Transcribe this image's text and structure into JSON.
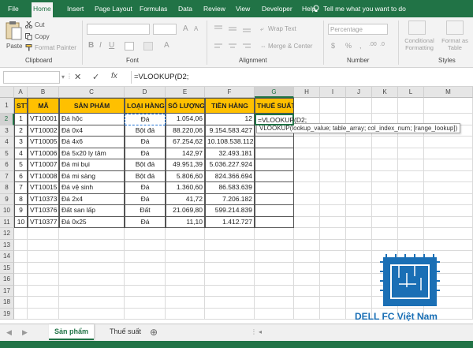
{
  "ribbon_tabs": [
    "File",
    "Home",
    "Insert",
    "Page Layout",
    "Formulas",
    "Data",
    "Review",
    "View",
    "Developer",
    "Help"
  ],
  "active_tab": "Home",
  "tell_me": "Tell me what you want to do",
  "clipboard": {
    "paste": "Paste",
    "cut": "Cut",
    "copy": "Copy",
    "format_painter": "Format Painter",
    "label": "Clipboard"
  },
  "font": {
    "label": "Font"
  },
  "alignment": {
    "wrap_text": "Wrap Text",
    "merge_center": "Merge & Center",
    "label": "Alignment"
  },
  "number": {
    "format": "Percentage",
    "label": "Number"
  },
  "styles": {
    "conditional_formatting": "Conditional Formatting",
    "format_as_table": "Format as Table",
    "label": "Styles"
  },
  "formula_bar": {
    "formula": "=VLOOKUP(D2;"
  },
  "columns": [
    "A",
    "B",
    "C",
    "D",
    "E",
    "F",
    "G",
    "H",
    "I",
    "J",
    "K",
    "L",
    "M"
  ],
  "rows": [
    "1",
    "2",
    "3",
    "4",
    "5",
    "6",
    "7",
    "8",
    "9",
    "10",
    "11",
    "12",
    "13",
    "14",
    "15",
    "16",
    "17",
    "18",
    "19"
  ],
  "table": {
    "headers": [
      "STT",
      "MÃ",
      "SẢN PHẨM",
      "LOẠI HÀNG",
      "SỐ LƯỢNG",
      "TIỀN HÀNG",
      "THUẾ SUẤT"
    ],
    "rows": [
      [
        "1",
        "VT10001",
        "Đá hộc",
        "Đá",
        "1.054,06",
        "12",
        ""
      ],
      [
        "2",
        "VT10002",
        "Đá 0x4",
        "Bột đá",
        "88.220,06",
        "9.154.583.427",
        ""
      ],
      [
        "3",
        "VT10005",
        "Đá 4x6",
        "Đá",
        "67.254,62",
        "10.108.538.112",
        ""
      ],
      [
        "4",
        "VT10006",
        "Đá 5x20 ly tâm",
        "Đá",
        "142,97",
        "32.493.181",
        ""
      ],
      [
        "5",
        "VT10007",
        "Đá mi bụi",
        "Bột đá",
        "49.951,39",
        "5.036.227.924",
        ""
      ],
      [
        "6",
        "VT10008",
        "Đá mi sàng",
        "Bột đá",
        "5.806,60",
        "824.366.694",
        ""
      ],
      [
        "7",
        "VT10015",
        "Đá vệ sinh",
        "Đá",
        "1.360,60",
        "86.583.639",
        ""
      ],
      [
        "8",
        "VT10373",
        "Đá 2x4",
        "Đá",
        "41,72",
        "7.206.182",
        ""
      ],
      [
        "9",
        "VT10376",
        "Đất san lấp",
        "Đất",
        "21.069,80",
        "599.214.839",
        ""
      ],
      [
        "10",
        "VT10377",
        "Đá 0x25",
        "Đá",
        "11,10",
        "1.412.727",
        ""
      ]
    ]
  },
  "active_cell_text": "=VLOOKUP(D2;",
  "tooltip": "VLOOKUP(lookup_value; table_array; col_index_num; [range_lookup])",
  "sheets": [
    "Sản phẩm",
    "Thuế suất"
  ],
  "active_sheet": "Sản phẩm",
  "watermark": "DELL FC Việt Nam",
  "colors": {
    "excel_green": "#217346",
    "header_fill": "#ffc000"
  }
}
